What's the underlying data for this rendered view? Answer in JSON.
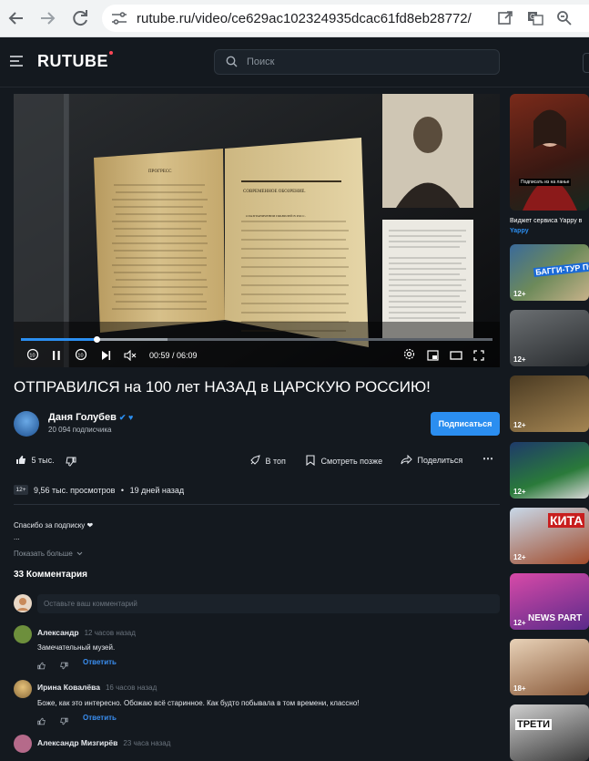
{
  "browser": {
    "url": "rutube.ru/video/ce629ac102324935dcac61fd8eb28772/",
    "icons": [
      "back-arrow-icon",
      "forward-arrow-icon",
      "reload-icon",
      "tune-icon",
      "open-external-icon",
      "translate-icon",
      "zoom-icon"
    ]
  },
  "site": {
    "logo": "RUTUBE",
    "search_placeholder": "Поиск",
    "accent": "#2b8ef0",
    "logo_dot": "#ff4757"
  },
  "player": {
    "time_current": "00:59",
    "time_total": "06:09",
    "time_display": "00:59 / 06:09",
    "progress_fraction": 0.16,
    "buffered_fraction": 0.31,
    "seek_back_label": "10",
    "seek_fwd_label": "10",
    "page_heading": "ПРОГРЕСС",
    "page_masthead": "СОВРЕМЕННОЕ ОБОЗРЕНИЕ.",
    "page_section": "О РАЗГРАНИЧЕНИИ ПРАВИЛЕЙ В РОСС."
  },
  "video": {
    "title": "ОТПРАВИЛСЯ на 100 лет НАЗАД в ЦАРСКУЮ РОССИЮ!",
    "channel_name": "Даня Голубев",
    "verified_badges": "✔ ♥",
    "subscribers": "20 094 подписчика",
    "subscribe_label": "Подписаться",
    "likes": "5 тыс.",
    "actions": {
      "top": "В топ",
      "watch_later": "Смотреть позже",
      "share": "Поделиться",
      "more": "⋯"
    },
    "age_rating": "12+",
    "views": "9,56 тыс. просмотров",
    "published": "19 дней назад",
    "description_line1": "Спасибо за подписку ❤",
    "description_line2": "...",
    "show_more": "Показать больше"
  },
  "comments": {
    "header": "33 Комментария",
    "input_placeholder": "Оставьте ваш комментарий",
    "reply_label": "Ответить",
    "items": [
      {
        "author": "Александр",
        "time": "12 часов назад",
        "text": "Замечательный музей."
      },
      {
        "author": "Ирина Ковалёва",
        "time": "16 часов назад",
        "text": "Боже, как это интересно. Обожаю всё старинное. Как будто побывала в том времени, классно!"
      },
      {
        "author": "Александр Мизгирёв",
        "time": "23 часа назад",
        "text": ""
      }
    ]
  },
  "sidebar": {
    "first_caption_title": "Виджет сервиса Yappy в",
    "first_caption_channel": "Yappy",
    "first_overlay": "Подписать из на ланье",
    "items": [
      {
        "age": "12+",
        "overlay": "БАГГИ-ТУР ПО КАВКАЗУ!"
      },
      {
        "age": "12+",
        "overlay": ""
      },
      {
        "age": "12+",
        "overlay": ""
      },
      {
        "age": "12+",
        "overlay": ""
      },
      {
        "age": "12+",
        "overlay": "КИТА"
      },
      {
        "age": "12+",
        "overlay": "NEWS PART"
      },
      {
        "age": "18+",
        "overlay": ""
      },
      {
        "age": "",
        "overlay": "ТРЕТИ"
      }
    ]
  }
}
